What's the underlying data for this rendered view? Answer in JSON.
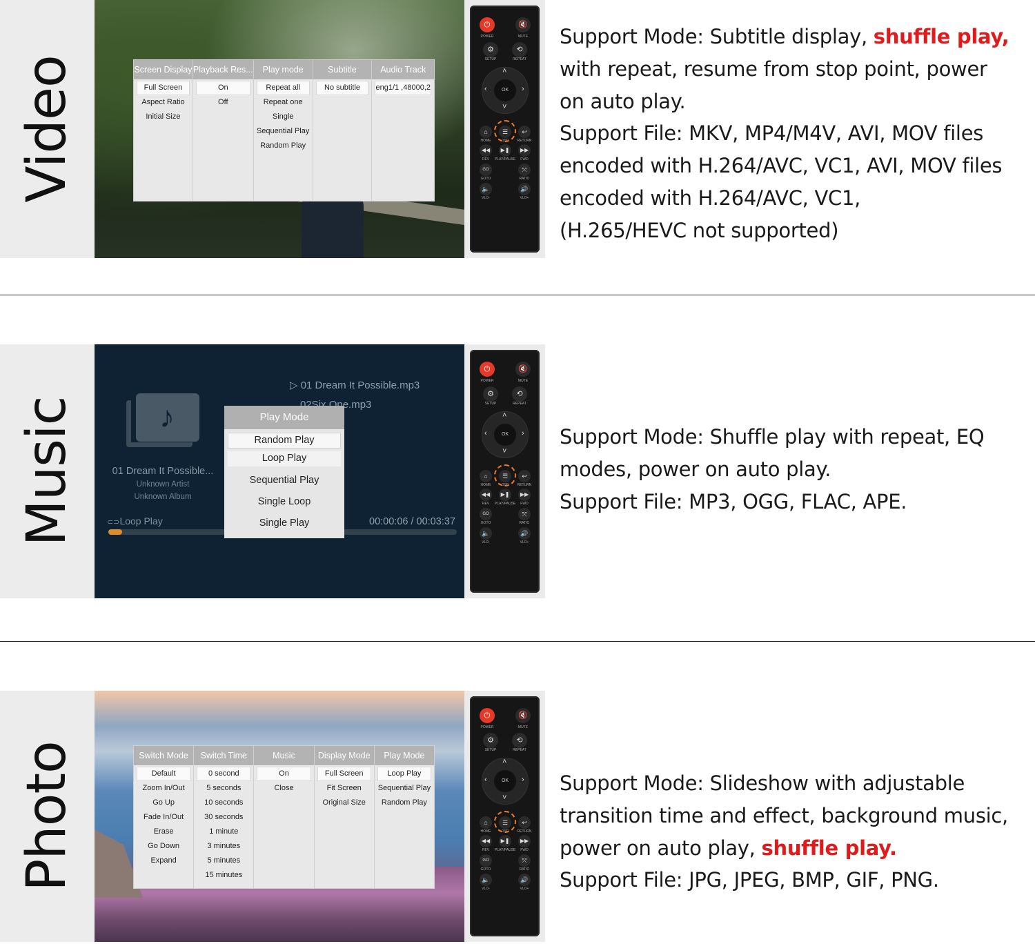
{
  "video": {
    "label": "Video",
    "menu": {
      "columns": [
        {
          "header": "Screen Display",
          "options": [
            "Full Screen",
            "Aspect Ratio",
            "Initial Size"
          ],
          "selected": 0
        },
        {
          "header": "Playback Res...",
          "options": [
            "On",
            "Off"
          ],
          "selected": 0
        },
        {
          "header": "Play mode",
          "options": [
            "Repeat all",
            "Repeat one",
            "Single",
            "Sequential Play",
            "Random Play"
          ],
          "selected": 0
        },
        {
          "header": "Subtitle",
          "options": [
            "No subtitle"
          ],
          "selected": 0
        },
        {
          "header": "Audio Track",
          "options": [
            "eng1/1 ,48000,2"
          ],
          "selected": 0
        }
      ]
    },
    "desc": {
      "l1a": "Support Mode: Subtitle display, ",
      "l1b": "shuffle play,",
      "l2": "with repeat, resume from stop point, power",
      "l3": "on auto play.",
      "l4": "Support File: MKV, MP4/M4V, AVI, MOV files",
      "l5": "encoded with H.264/AVC, VC1, AVI, MOV files",
      "l6": "encoded with H.264/AVC, VC1,",
      "l7": "(H.265/HEVC not supported)"
    }
  },
  "music": {
    "label": "Music",
    "playlist": [
      "01 Dream It Possible.mp3",
      "02Six One.mp3"
    ],
    "track_title": "01 Dream It Possible...",
    "artist": "Unknown Artist",
    "album": "Unknown Album",
    "loop_label": "Loop Play",
    "time": "00:00:06 / 00:03:37",
    "progress": 0.04,
    "popup": {
      "header": "Play Mode",
      "options": [
        "Random Play",
        "Loop Play",
        "Sequential Play",
        "Single Loop",
        "Single Play"
      ]
    },
    "desc": {
      "l1": "Support Mode: Shuffle play with repeat, EQ",
      "l2": "modes, power on auto play.",
      "l3": "Support File: MP3, OGG, FLAC, APE."
    }
  },
  "photo": {
    "label": "Photo",
    "menu": {
      "columns": [
        {
          "header": "Switch Mode",
          "options": [
            "Default",
            "Zoom In/Out",
            "Go Up",
            "Fade In/Out",
            "Erase",
            "Go Down",
            "Expand"
          ],
          "selected": 0
        },
        {
          "header": "Switch Time",
          "options": [
            "0 second",
            "5 seconds",
            "10 seconds",
            "30 seconds",
            "1 minute",
            "3 minutes",
            "5 minutes",
            "15 minutes"
          ],
          "selected": 0
        },
        {
          "header": "Music",
          "options": [
            "On",
            "Close"
          ],
          "selected": 0
        },
        {
          "header": "Display Mode",
          "options": [
            "Full Screen",
            "Fit Screen",
            "Original Size"
          ],
          "selected": 0
        },
        {
          "header": "Play Mode",
          "options": [
            "Loop Play",
            "Sequential Play",
            "Random Play"
          ],
          "selected": 0
        }
      ]
    },
    "desc": {
      "l1": "Support Mode: Slideshow with adjustable",
      "l2": "transition time and effect, background music,",
      "l3a": "power on auto play, ",
      "l3b": "shuffle play.",
      "l4": "Support File: JPG, JPEG, BMP, GIF, PNG."
    }
  },
  "remote": {
    "labels": {
      "power": "POWER",
      "mute": "MUTE",
      "setup": "SETUP",
      "repeat": "REPEAT",
      "ok": "OK",
      "home": "HOME",
      "osd": "OSD",
      "return": "RETURN",
      "rev": "REV",
      "playpause": "PLAY/PAUSE",
      "fwd": "FWD",
      "goto": "GOTO",
      "ratio": "RATIO",
      "vol_minus": "VLO-",
      "vol_plus": "VLO+"
    },
    "accent": "#e53a2a",
    "highlight": "#f07a2a"
  },
  "colors": {
    "highlight_text": "#e01b1b"
  }
}
